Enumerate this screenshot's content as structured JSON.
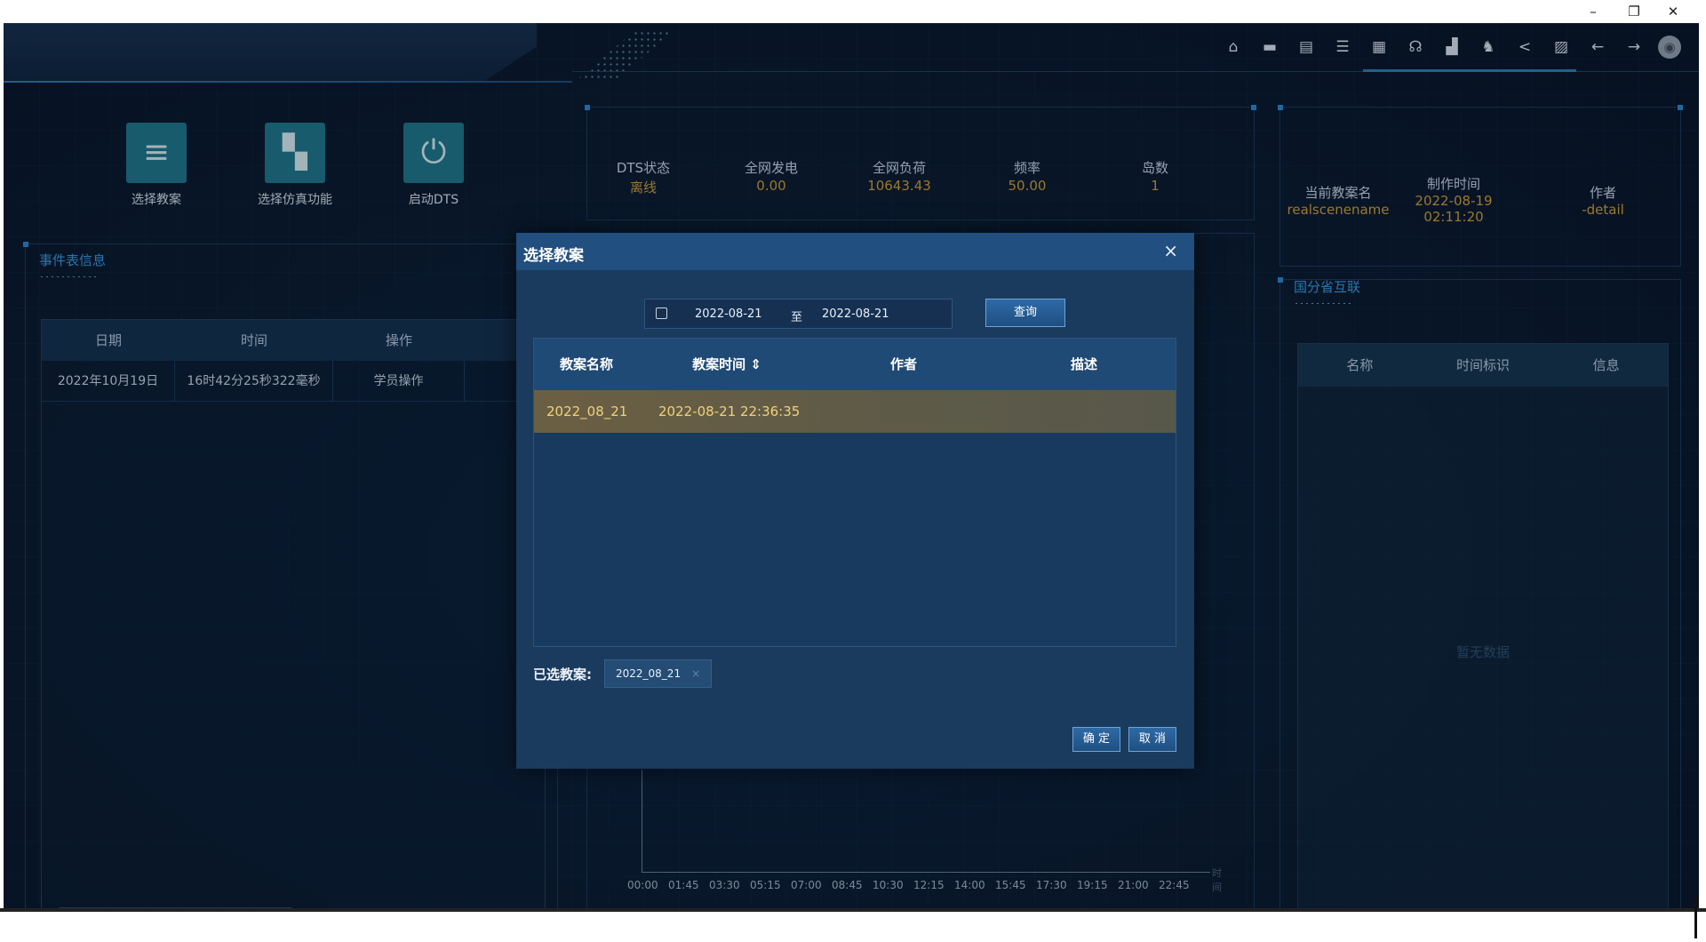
{
  "window_controls": {
    "minimize": "–",
    "restore": "❐",
    "close": "✕"
  },
  "toolbar": [
    "⌂",
    "▬",
    "▤",
    "☰",
    "▦",
    "☊",
    "▟",
    "♞",
    "<",
    "▨",
    "←",
    "→",
    "◉"
  ],
  "quick_actions": [
    {
      "label": "选择教案",
      "icon": "≡"
    },
    {
      "label": "选择仿真功能",
      "icon": "▚"
    },
    {
      "label": "启动DTS",
      "icon": "⏻"
    }
  ],
  "event_panel": {
    "title": "事件表信息",
    "headers": [
      "日期",
      "时间",
      "操作"
    ],
    "rows": [
      [
        "2022年10月19日",
        "16时42分25秒322毫秒",
        "学员操作"
      ]
    ]
  },
  "stats": [
    {
      "label": "DTS状态",
      "value": "离线"
    },
    {
      "label": "全网发电",
      "value": "0.00"
    },
    {
      "label": "全网负荷",
      "value": "10643.43"
    },
    {
      "label": "频率",
      "value": "50.00"
    },
    {
      "label": "岛数",
      "value": "1"
    }
  ],
  "case_info": [
    {
      "label": "当前教案名",
      "value": "realscenename"
    },
    {
      "label": "制作时间",
      "value": "2022-08-19 02:11:20"
    },
    {
      "label": "作者",
      "value": "-detail"
    }
  ],
  "right_panel": {
    "title": "国分省互联",
    "headers": [
      "名称",
      "时间标识",
      "信息"
    ],
    "empty": "暂无数据"
  },
  "chart_data": {
    "type": "line",
    "x": [
      "00:00",
      "01:45",
      "03:30",
      "05:15",
      "07:00",
      "08:45",
      "10:30",
      "12:15",
      "14:00",
      "15:45",
      "17:30",
      "19:15",
      "21:00",
      "22:45"
    ],
    "series": [],
    "xlabel": "时间",
    "ylabel": ""
  },
  "dialog": {
    "title": "选择教案",
    "close": "×",
    "date_from": "2022-08-21",
    "date_sep": "至",
    "date_to": "2022-08-21",
    "query": "查询",
    "headers": [
      "教案名称",
      "教案时间 ⇕",
      "作者",
      "描述"
    ],
    "rows": [
      {
        "name": "2022_08_21",
        "time": "2022-08-21 22:36:35",
        "author": "",
        "desc": ""
      }
    ],
    "selected_label": "已选教案:",
    "selected_tag": "2022_08_21",
    "tag_close": "×",
    "confirm": "确 定",
    "cancel": "取 消"
  }
}
